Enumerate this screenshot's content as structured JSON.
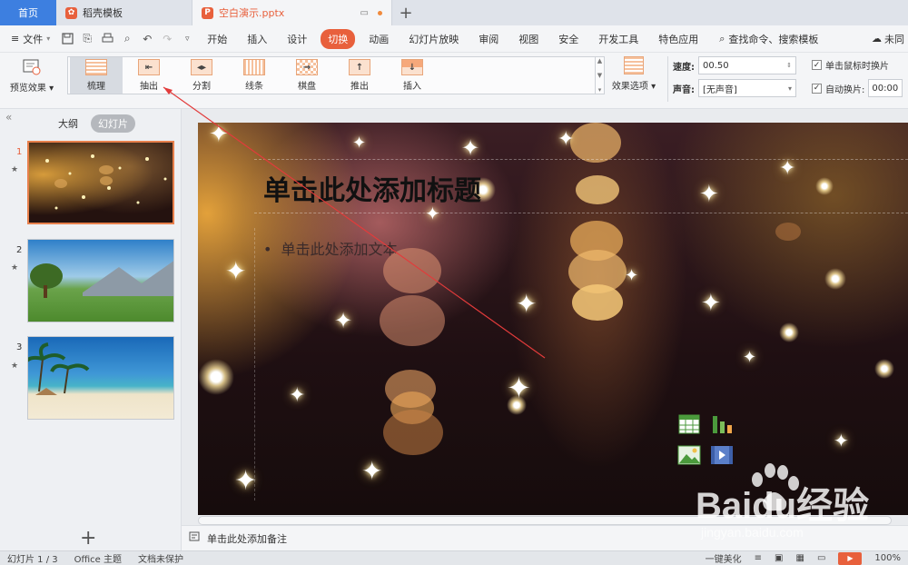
{
  "tabs": {
    "home": "首页",
    "template": "稻壳模板",
    "doc": "空白演示.pptx"
  },
  "menubar": {
    "file": "文件",
    "items": [
      "开始",
      "插入",
      "设计",
      "切换",
      "动画",
      "幻灯片放映",
      "审阅",
      "视图",
      "安全",
      "开发工具",
      "特色应用"
    ],
    "active": "切换",
    "search": "查找命令、搜索模板",
    "cloud": "未同"
  },
  "ribbon": {
    "preview": "预览效果",
    "effects": [
      "梳理",
      "抽出",
      "分割",
      "线条",
      "棋盘",
      "推出",
      "插入"
    ],
    "selected_effect": "梳理",
    "effect_options": "效果选项",
    "speed_label": "速度:",
    "speed_value": "00.50",
    "sound_label": "声音:",
    "sound_value": "[无声音]",
    "on_click": "单击鼠标时换片",
    "auto": "自动换片:",
    "auto_time": "00:00"
  },
  "left_panel": {
    "outline": "大纲",
    "slides": "幻灯片",
    "slide_numbers": [
      "1",
      "2",
      "3"
    ],
    "current": 1
  },
  "slide": {
    "title": "单击此处添加标题",
    "body": "单击此处添加文本"
  },
  "notes": {
    "placeholder": "单击此处添加备注"
  },
  "statusbar": {
    "slide_info": "幻灯片 1 / 3",
    "office": "Office 主题",
    "backup": "文档未保护",
    "beautify": "一键美化",
    "zoom": "100%"
  },
  "watermark": {
    "main": "Baidu经验",
    "sub": "jingyan.baidu.com"
  },
  "colors": {
    "accent": "#e8603c",
    "home_tab": "#3d7fe0"
  }
}
